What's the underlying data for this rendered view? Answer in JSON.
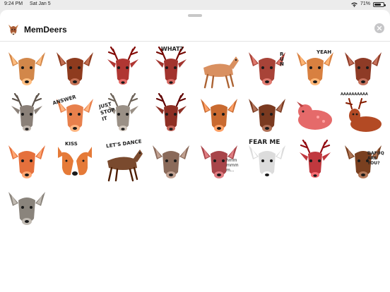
{
  "status_bar": {
    "time": "9:24 PM",
    "date": "Sat Jan 5",
    "battery": "71%",
    "battery_level": 0.71
  },
  "header": {
    "title": "MemDeers"
  },
  "stickers": [
    {
      "id": 1,
      "caption": "",
      "icon": "deer-face-icon",
      "color": "#d2874a"
    },
    {
      "id": 2,
      "caption": "",
      "icon": "deer-face-icon",
      "color": "#8e3b1e"
    },
    {
      "id": 3,
      "caption": "",
      "icon": "stag-face-icon",
      "color": "#b03632"
    },
    {
      "id": 4,
      "caption": "WHAT?",
      "icon": "stag-face-icon",
      "color": "#a2342e"
    },
    {
      "id": 5,
      "caption": "",
      "icon": "deer-body-icon",
      "color": "#d99060"
    },
    {
      "id": 6,
      "caption": "RUN",
      "icon": "deer-face-icon",
      "color": "#a84338"
    },
    {
      "id": 7,
      "caption": "YEAH",
      "icon": "deer-face-icon",
      "color": "#d88040"
    },
    {
      "id": 8,
      "caption": "",
      "icon": "deer-face-icon",
      "color": "#8e3b26"
    },
    {
      "id": 9,
      "caption": "",
      "icon": "stag-face-icon",
      "color": "#8a8078"
    },
    {
      "id": 10,
      "caption": "ANSWER",
      "icon": "deer-face-icon",
      "color": "#e8804c"
    },
    {
      "id": 11,
      "caption": "JUST STOP IT",
      "icon": "stag-face-icon",
      "color": "#9a9086"
    },
    {
      "id": 12,
      "caption": "",
      "icon": "stag-face-icon",
      "color": "#8e2f24"
    },
    {
      "id": 13,
      "caption": "",
      "icon": "deer-face-icon",
      "color": "#c96a30"
    },
    {
      "id": 14,
      "caption": "",
      "icon": "deer-face-icon",
      "color": "#7a3a20"
    },
    {
      "id": 15,
      "caption": "",
      "icon": "fawn-lying-icon",
      "color": "#e56a6a"
    },
    {
      "id": 16,
      "caption": "AAAAAAAAAA",
      "icon": "stag-lying-icon",
      "color": "#b34a24"
    },
    {
      "id": 17,
      "caption": "",
      "icon": "deer-face-icon",
      "color": "#e5703c"
    },
    {
      "id": 18,
      "caption": "KISS",
      "icon": "deer-pair-icon",
      "color": "#e57a38"
    },
    {
      "id": 19,
      "caption": "LET'S DANCE",
      "icon": "deer-body-icon",
      "color": "#7a4a2e"
    },
    {
      "id": 20,
      "caption": "",
      "icon": "deer-face-icon",
      "color": "#8a6a5a"
    },
    {
      "id": 21,
      "caption": "hmm mmm m...",
      "icon": "deer-face-icon",
      "color": "#a8454a"
    },
    {
      "id": 22,
      "caption": "FEAR ME",
      "icon": "deer-face-icon",
      "color": "#dcdcdc"
    },
    {
      "id": 23,
      "caption": "",
      "icon": "stag-face-icon",
      "color": "#c0383e"
    },
    {
      "id": 24,
      "caption": "DAFUQ ARE YOU?",
      "icon": "deer-face-icon",
      "color": "#7a4020"
    },
    {
      "id": 25,
      "caption": "",
      "icon": "deer-face-icon",
      "color": "#8a847c"
    }
  ]
}
